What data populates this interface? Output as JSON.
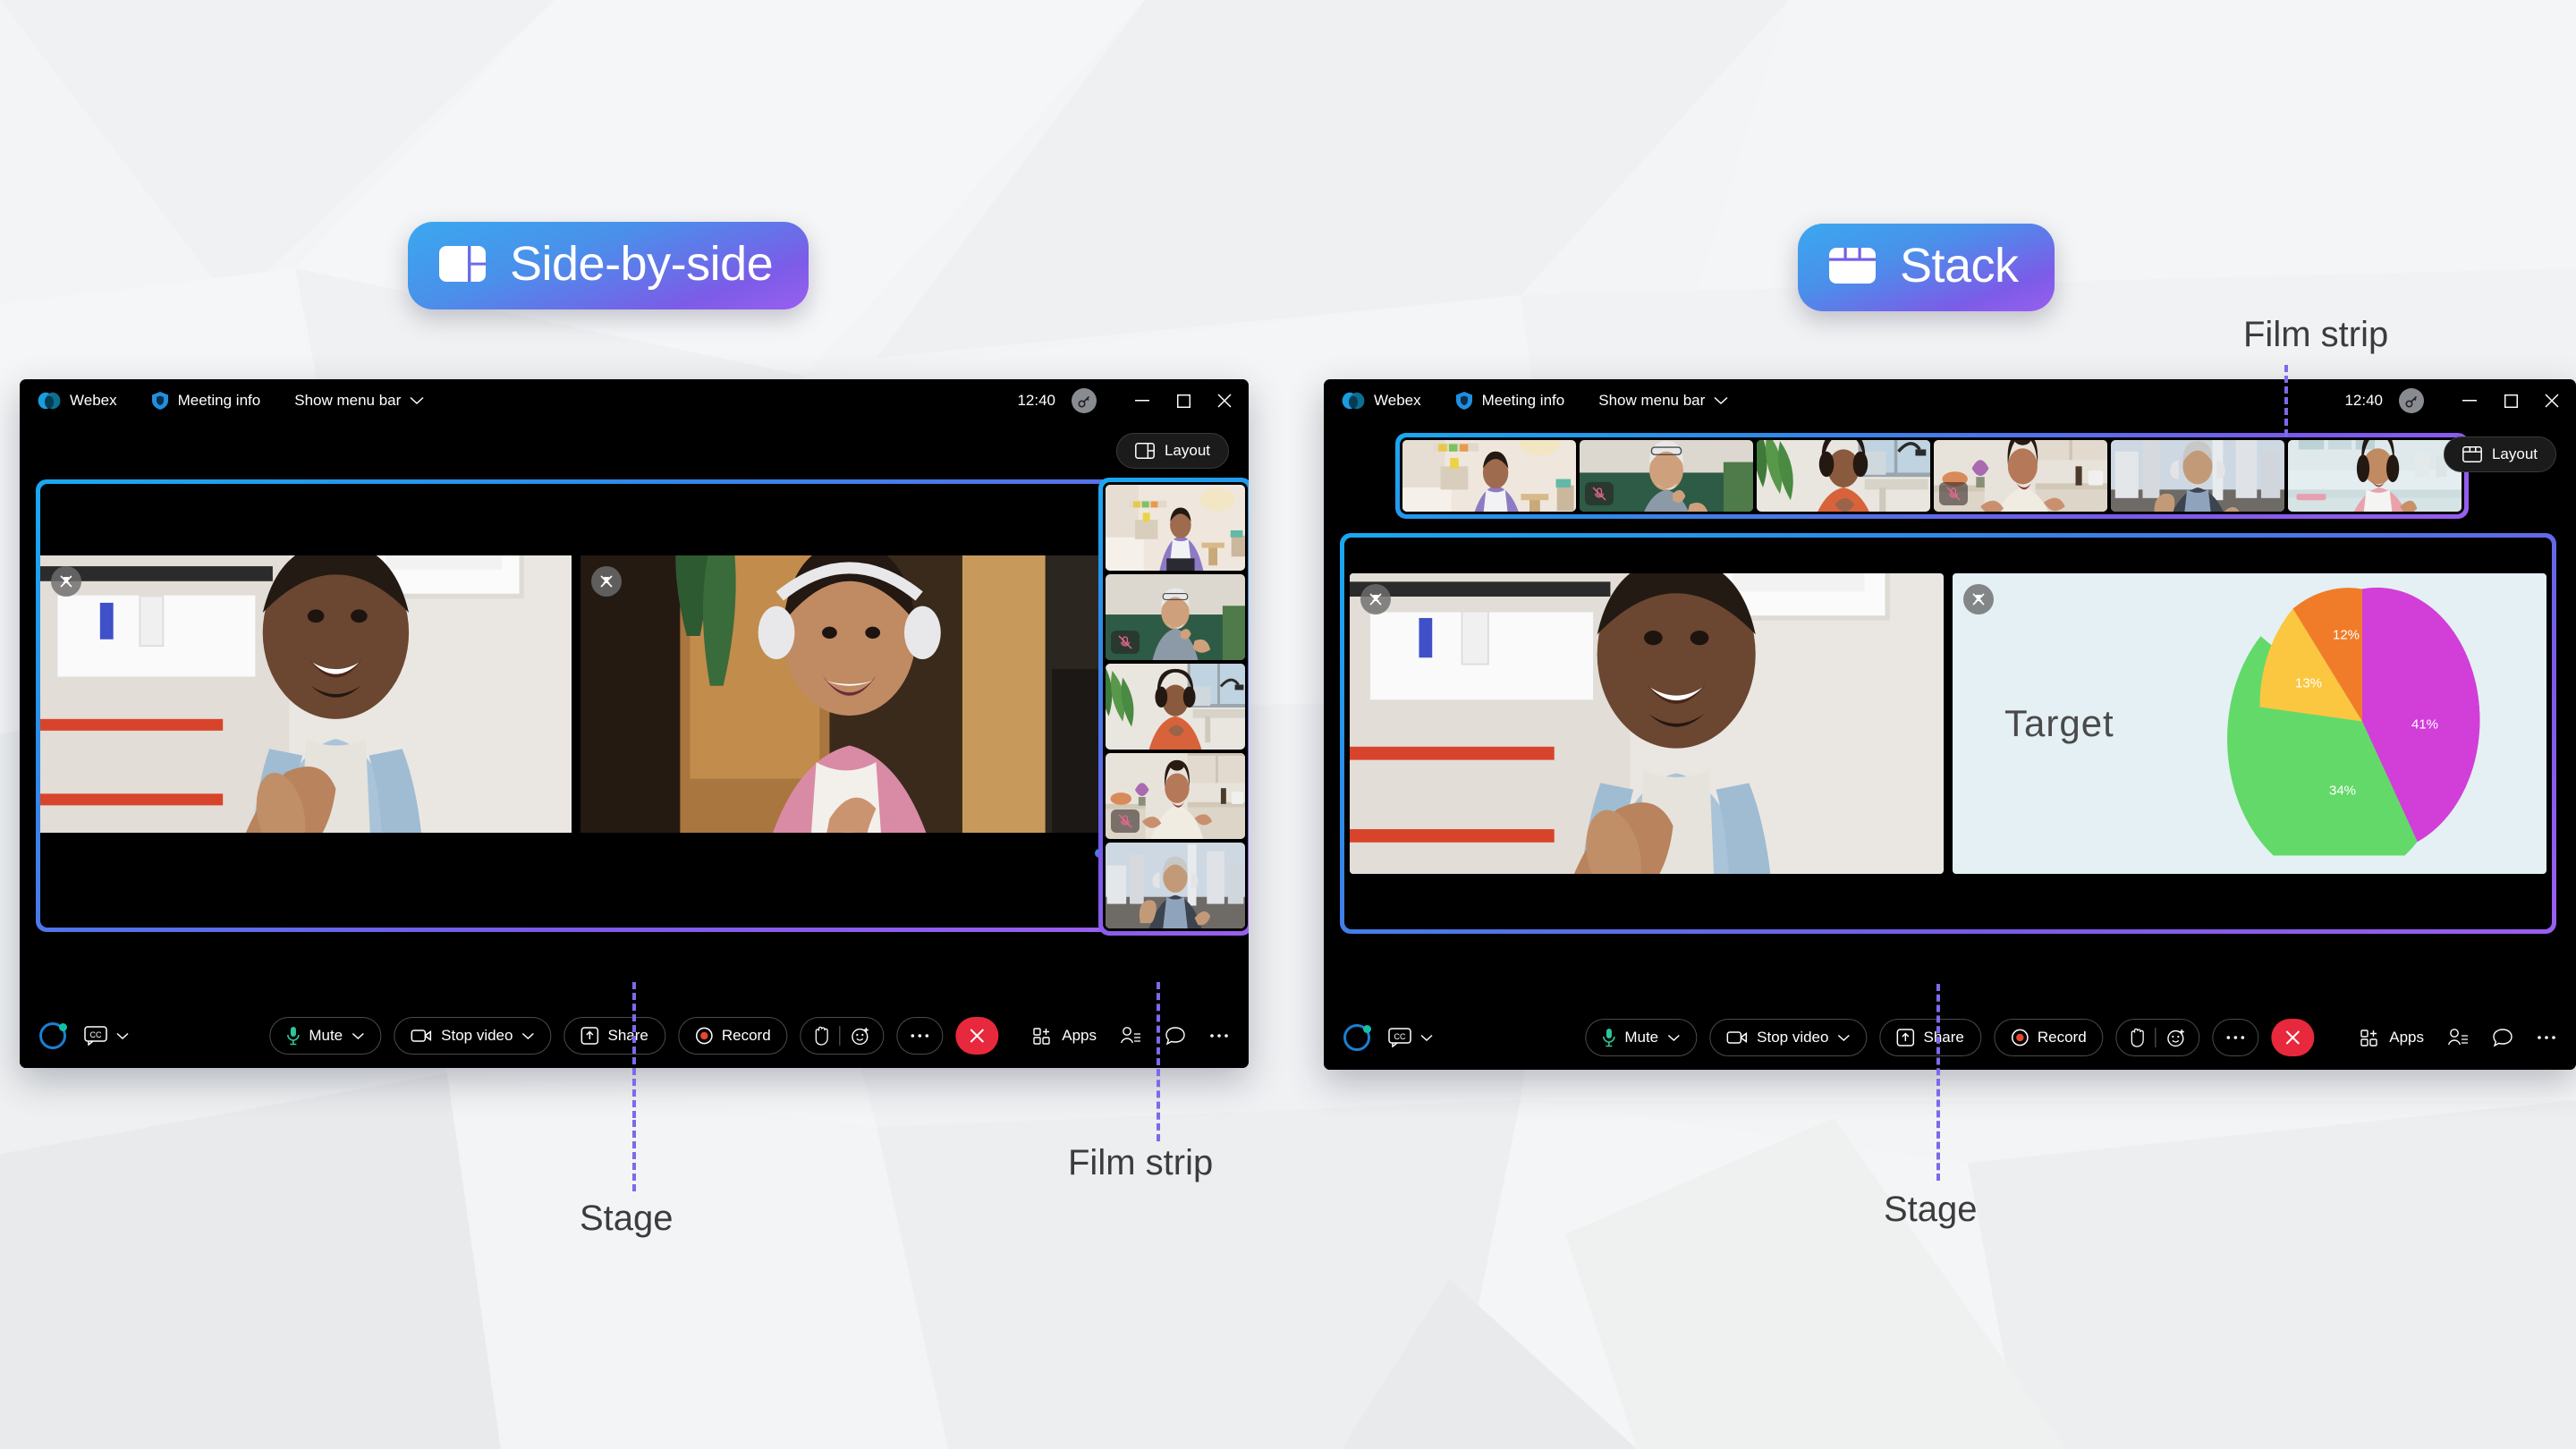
{
  "page": {
    "background_color": "#f2f3f4",
    "accent_gradient_from": "#19a8f0",
    "accent_gradient_to": "#9a5ff0",
    "annotation_color": "#3c3c3c",
    "leader_color": "#7b6bea"
  },
  "badges": {
    "side_by_side": {
      "label": "Side-by-side",
      "icon": "layout-side-by-side-icon"
    },
    "stack": {
      "label": "Stack",
      "icon": "layout-stack-icon"
    }
  },
  "annotations": {
    "left_stage": "Stage",
    "left_filmstrip": "Film strip",
    "right_stage": "Stage",
    "right_filmstrip": "Film strip"
  },
  "window_left": {
    "titlebar": {
      "app_name": "Webex",
      "meeting_info": "Meeting info",
      "menu_bar": "Show menu bar",
      "time": "12:40",
      "network_icon": "connection-key-icon",
      "minimize": "minimize-icon",
      "maximize": "maximize-icon",
      "close": "close-icon"
    },
    "layout_button": {
      "label": "Layout",
      "icon": "layout-side-by-side-icon"
    },
    "stage": {
      "tiles": [
        {
          "name": "participant-thumbs-up",
          "pin": "pin-icon"
        },
        {
          "name": "participant-headphones",
          "pin": "pin-icon"
        }
      ]
    },
    "filmstrip": {
      "tiles": [
        {
          "name": "participant-purple-shirt",
          "muted": false
        },
        {
          "name": "participant-gray-beard",
          "muted": true
        },
        {
          "name": "participant-orange-top",
          "muted": false
        },
        {
          "name": "participant-kitchen",
          "muted": true
        },
        {
          "name": "participant-waving-headset",
          "muted": false
        }
      ]
    },
    "controls": {
      "assistant_icon": "ai-assistant-icon",
      "captions_label": "CC",
      "mute": "Mute",
      "stop_video": "Stop video",
      "share": "Share",
      "record": "Record",
      "raise_hand_icon": "raise-hand-icon",
      "reactions_icon": "reactions-icon",
      "more_icon": "more-icon",
      "end_call_icon": "end-call-icon",
      "apps": "Apps",
      "participants_icon": "participants-icon",
      "chat_icon": "chat-icon",
      "more_right_icon": "more-icon"
    }
  },
  "window_right": {
    "titlebar": {
      "app_name": "Webex",
      "meeting_info": "Meeting info",
      "menu_bar": "Show menu bar",
      "time": "12:40",
      "network_icon": "connection-key-icon",
      "minimize": "minimize-icon",
      "maximize": "maximize-icon",
      "close": "close-icon"
    },
    "layout_button": {
      "label": "Layout",
      "icon": "layout-stack-icon"
    },
    "filmstrip": {
      "tiles": [
        {
          "name": "participant-purple-shirt",
          "muted": false
        },
        {
          "name": "participant-gray-beard",
          "muted": true
        },
        {
          "name": "participant-orange-top",
          "muted": false
        },
        {
          "name": "participant-kitchen",
          "muted": true
        },
        {
          "name": "participant-waving-headset",
          "muted": false
        },
        {
          "name": "participant-pink-jacket",
          "muted": false
        }
      ]
    },
    "stage": {
      "tiles": [
        {
          "name": "participant-thumbs-up",
          "pin": "pin-icon"
        },
        {
          "name": "shared-slide-target",
          "pin": "pin-icon"
        }
      ]
    },
    "controls": {
      "assistant_icon": "ai-assistant-icon",
      "captions_label": "CC",
      "mute": "Mute",
      "stop_video": "Stop video",
      "share": "Share",
      "record": "Record",
      "raise_hand_icon": "raise-hand-icon",
      "reactions_icon": "reactions-icon",
      "more_icon": "more-icon",
      "end_call_icon": "end-call-icon",
      "apps": "Apps",
      "participants_icon": "participants-icon",
      "chat_icon": "chat-icon",
      "more_right_icon": "more-icon"
    }
  },
  "chart_data": {
    "type": "pie",
    "title": "Target",
    "labels": [
      "41%",
      "34%",
      "13%",
      "12%"
    ],
    "values": [
      41,
      34,
      13,
      12
    ],
    "colors": [
      "#d13fd8",
      "#63d96a",
      "#fbc740",
      "#f07c29"
    ],
    "background": "#e4f0f4",
    "label_color": "#ffffff",
    "title_color": "#4a4a4a",
    "legend": "none",
    "grid": false
  }
}
